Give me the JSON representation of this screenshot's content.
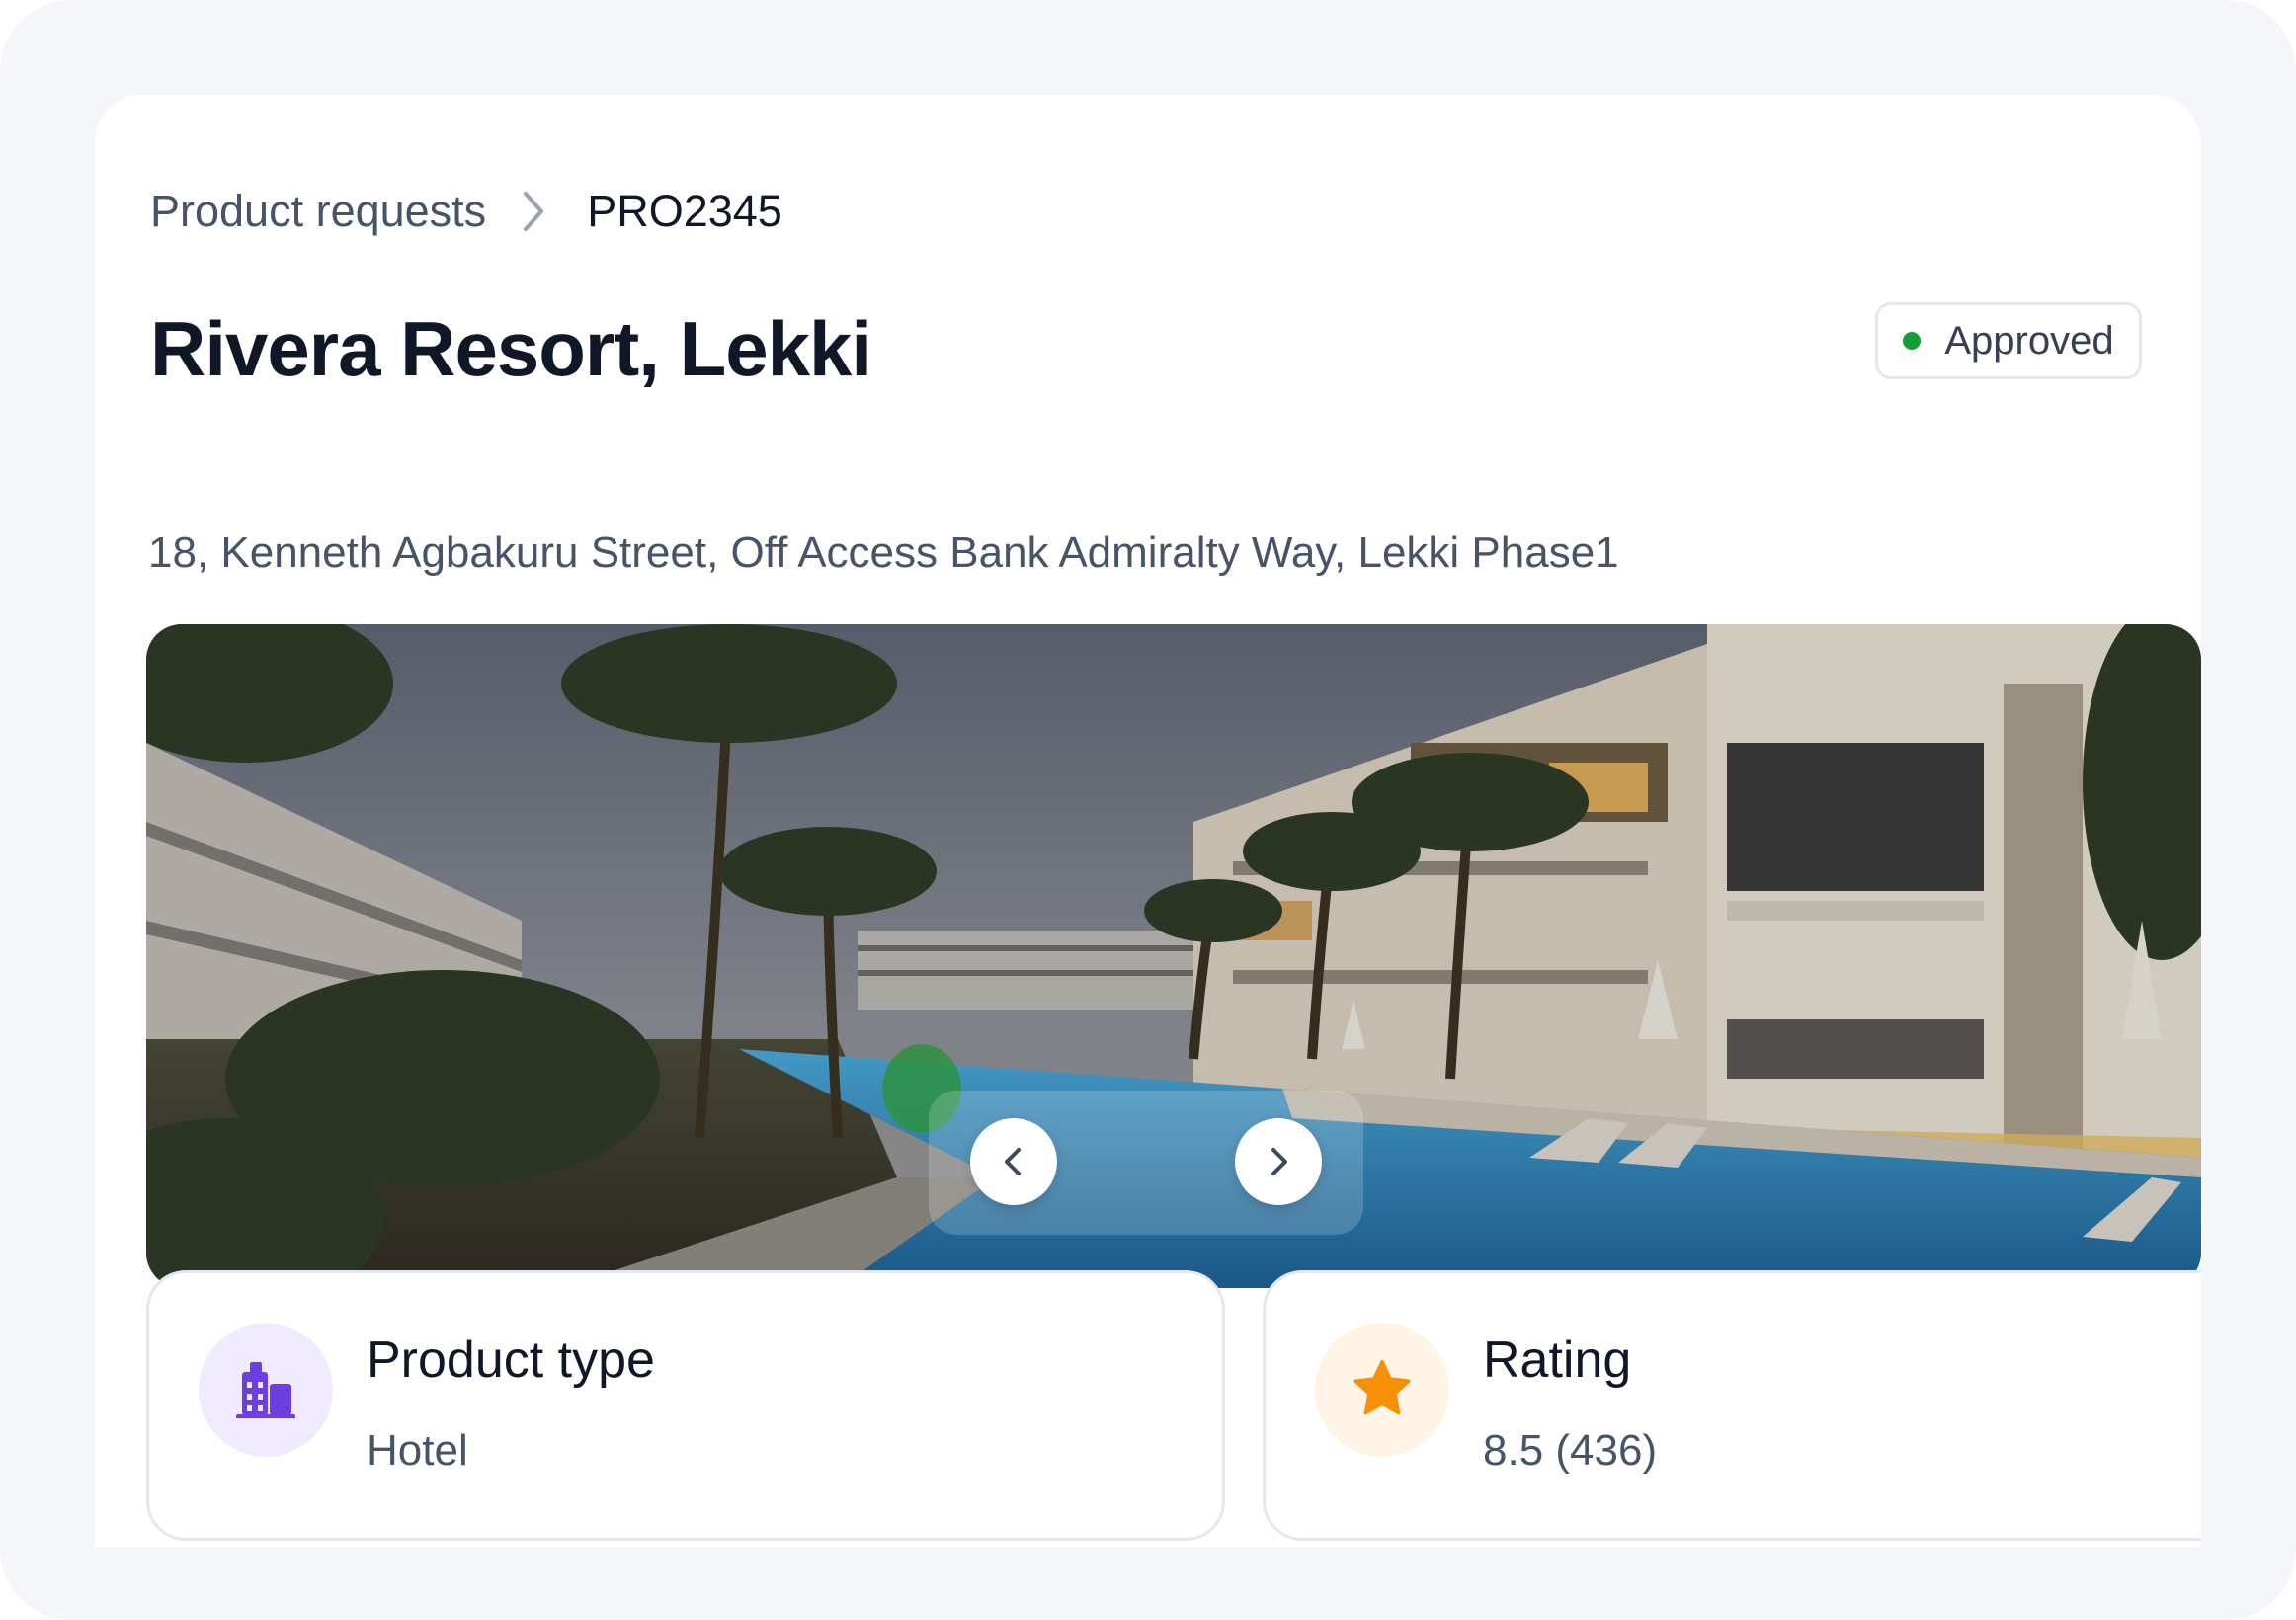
{
  "breadcrumb": {
    "parent": "Product requests",
    "current": "PRO2345"
  },
  "product": {
    "title": "Rivera Resort, Lekki",
    "address": "18, Kenneth Agbakuru Street, Off Access Bank Admiralty Way, Lekki Phase1",
    "status": "Approved",
    "status_color": "#12a035"
  },
  "gallery": {
    "prev_icon": "chevron-left-icon",
    "next_icon": "chevron-right-icon"
  },
  "details": {
    "product_type": {
      "label": "Product type",
      "value": "Hotel",
      "icon": "building-icon",
      "icon_color": "#6d3fe0"
    },
    "rating": {
      "label": "Rating",
      "value": "8.5 (436)",
      "icon": "star-icon",
      "icon_color": "#f79009"
    }
  }
}
